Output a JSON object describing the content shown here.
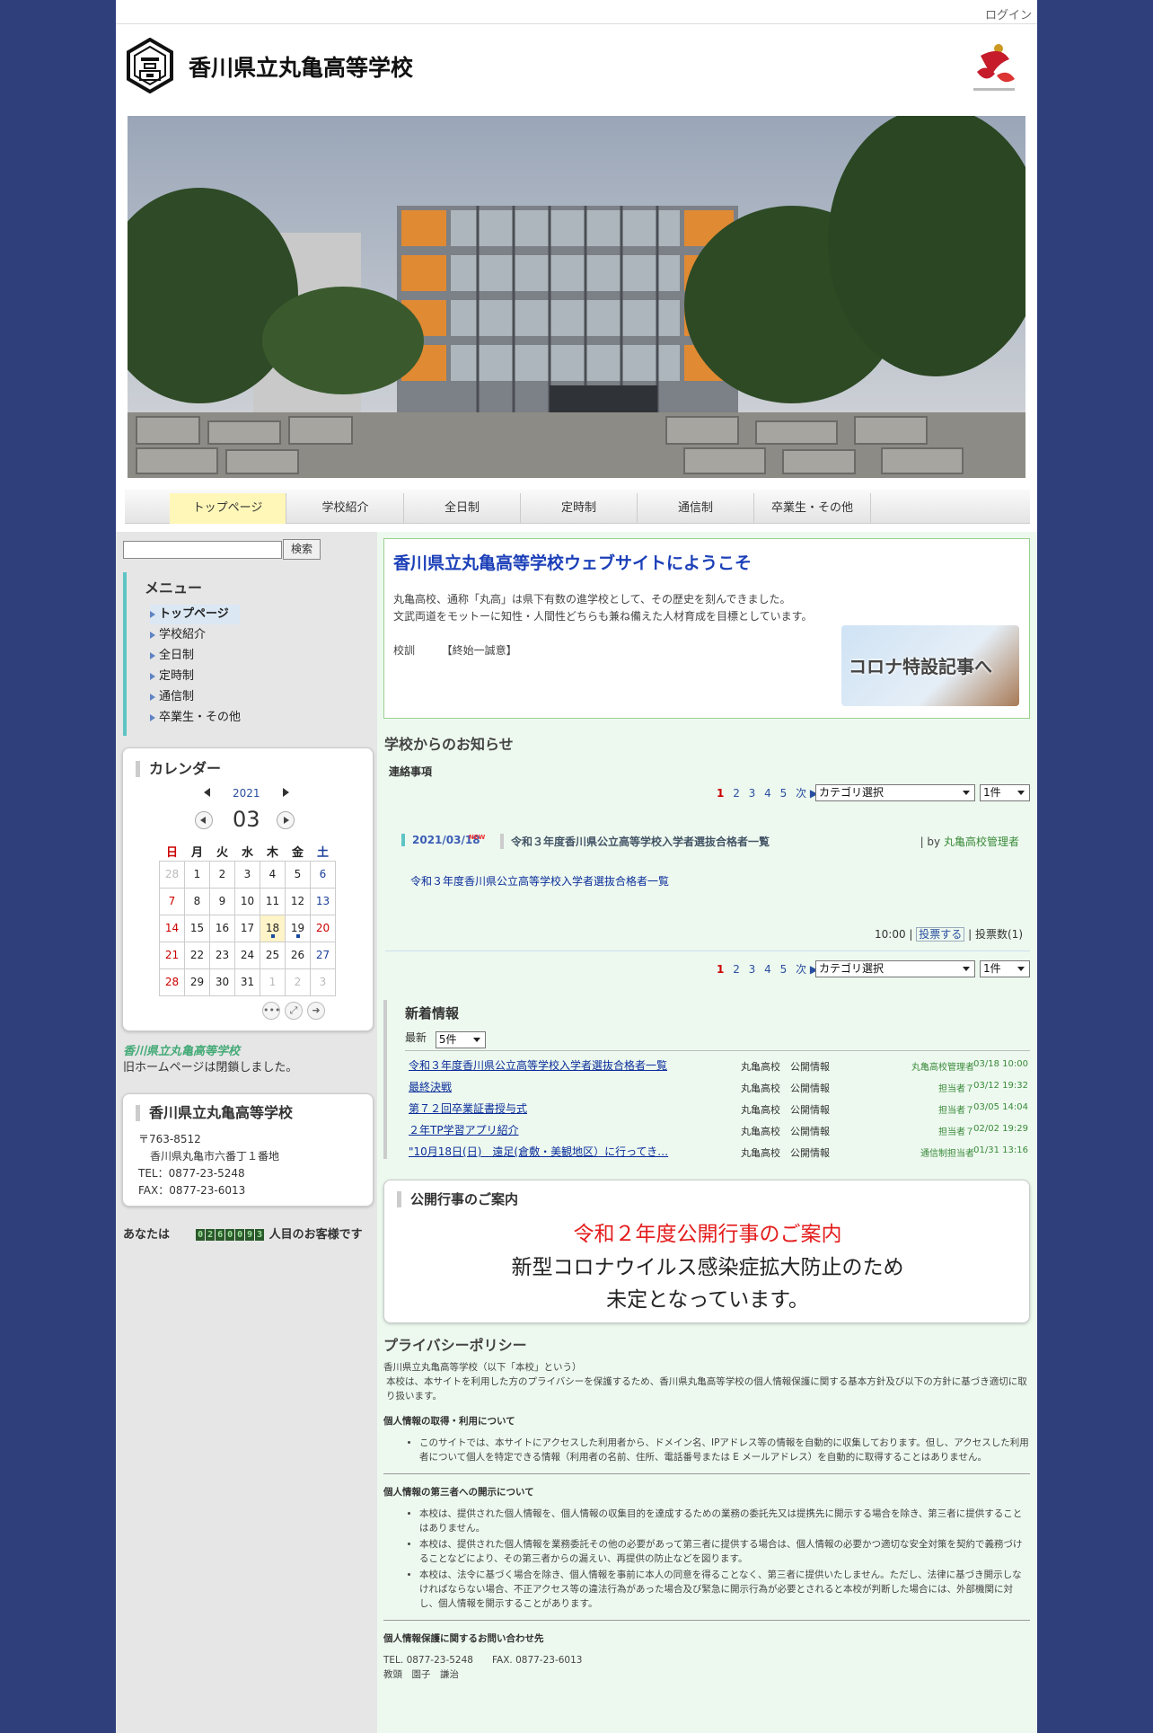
{
  "header": {
    "login": "ログイン",
    "site_title": "香川県立丸亀高等学校"
  },
  "nav": {
    "items": [
      {
        "label": "トップページ",
        "active": true
      },
      {
        "label": "学校紹介"
      },
      {
        "label": "全日制"
      },
      {
        "label": "定時制"
      },
      {
        "label": "通信制"
      },
      {
        "label": "卒業生・その他"
      }
    ]
  },
  "search": {
    "button": "検索",
    "value": ""
  },
  "menu": {
    "title": "メニュー",
    "items": [
      "トップページ",
      "学校紹介",
      "全日制",
      "定時制",
      "通信制",
      "卒業生・その他"
    ]
  },
  "calendar": {
    "title": "カレンダー",
    "year": "2021",
    "month": "03",
    "weekdays": [
      "日",
      "月",
      "火",
      "水",
      "木",
      "金",
      "土"
    ],
    "weeks": [
      [
        "28",
        "1",
        "2",
        "3",
        "4",
        "5",
        "6"
      ],
      [
        "7",
        "8",
        "9",
        "10",
        "11",
        "12",
        "13"
      ],
      [
        "14",
        "15",
        "16",
        "17",
        "18",
        "19",
        "20"
      ],
      [
        "21",
        "22",
        "23",
        "24",
        "25",
        "26",
        "27"
      ],
      [
        "28",
        "29",
        "30",
        "31",
        "1",
        "2",
        "3"
      ]
    ]
  },
  "old_homepage": {
    "banner": "香川県立丸亀高等学校",
    "note": "旧ホームページは閉鎖しました。"
  },
  "address": {
    "title": "香川県立丸亀高等学校",
    "postal": "〒763-8512",
    "street": "香川県丸亀市六番丁１番地",
    "tel": "TEL：0877-23-5248",
    "fax": "FAX：0877-23-6013"
  },
  "counter": {
    "prefix": "あなたは",
    "digits": "0260093",
    "suffix": "人目のお客様です"
  },
  "welcome": {
    "title": "香川県立丸亀高等学校ウェブサイトにようこそ",
    "line1": "丸亀高校、通称「丸高」は県下有数の進学校として、その歴史を刻んできました。",
    "line2": "文武両道をモットーに知性・人間性どちらも兼ね備えた人材育成を目標としています。",
    "motto_label": "校訓",
    "motto": "【終始一誠意】",
    "banner": "コロナ特設記事へ"
  },
  "notices": {
    "title": "学校からのお知らせ",
    "subtitle": "連絡事項",
    "pages": [
      "1",
      "2",
      "3",
      "4",
      "5"
    ],
    "next": "次",
    "category_select": "カテゴリ選択",
    "count_select": "1件",
    "post": {
      "date": "2021/03/18",
      "new_badge": "NEW",
      "title": "令和３年度香川県公立高等学校入学者選抜合格者一覧",
      "by": "| by",
      "author": "丸亀高校管理者",
      "link": "令和３年度香川県公立高等学校入学者選抜合格者一覧",
      "time": "10:00 |",
      "vote": "投票する",
      "votes": "| 投票数(1)"
    }
  },
  "whats_new": {
    "title": "新着情報",
    "latest_label": "最新",
    "latest_select": "5件",
    "rows": [
      {
        "title": "令和３年度香川県公立高等学校入学者選抜合格者一覧",
        "category": "丸亀高校　公開情報",
        "author": "丸亀高校管理者",
        "date": "03/18 10:00"
      },
      {
        "title": "最終決戦",
        "category": "丸亀高校　公開情報",
        "author": "担当者７",
        "date": "03/12 19:32"
      },
      {
        "title": "第７２回卒業証書授与式",
        "category": "丸亀高校　公開情報",
        "author": "担当者７",
        "date": "03/05 14:04"
      },
      {
        "title": "２年TP学習アプリ紹介",
        "category": "丸亀高校　公開情報",
        "author": "担当者７",
        "date": "02/02 19:29"
      },
      {
        "title": "\"10月18日(日)　遠足(倉敷・美観地区）に行ってき…",
        "category": "丸亀高校　公開情報",
        "author": "通信制担当者",
        "date": "01/31 13:16"
      }
    ]
  },
  "events": {
    "title": "公開行事のご案内",
    "line1": "令和２年度公開行事のご案内",
    "line2": "新型コロナウイルス感染症拡大防止のため",
    "line3": "未定となっています。"
  },
  "privacy": {
    "title": "プライバシーポリシー",
    "intro1": "香川県立丸亀高等学校（以下「本校」という）",
    "intro2": "本校は、本サイトを利用した方のプライバシーを保護するため、香川県丸亀高等学校の個人情報保護に関する基本方針及び以下の方針に基づき適切に取り扱います。",
    "h1": "個人情報の取得・利用について",
    "p1": "このサイトでは、本サイトにアクセスした利用者から、ドメイン名、IPアドレス等の情報を自動的に収集しております。但し、アクセスした利用者について個人を特定できる情報（利用者の名前、住所、電話番号または E メールアドレス）を自動的に取得することはありません。",
    "h2": "個人情報の第三者への開示について",
    "p2a": "本校は、提供された個人情報を、個人情報の収集目的を達成するための業務の委託先又は提携先に開示する場合を除き、第三者に提供することはありません。",
    "p2b": "本校は、提供された個人情報を業務委託その他の必要があって第三者に提供する場合は、個人情報の必要かつ適切な安全対策を契約で義務づけることなどにより、その第三者からの漏えい、再提供の防止などを図ります。",
    "p2c": "本校は、法令に基づく場合を除き、個人情報を事前に本人の同意を得ることなく、第三者に提供いたしません。ただし、法律に基づき開示しなければならない場合、不正アクセス等の違法行為があった場合及び緊急に開示行為が必要とされると本校が判断した場合には、外部機関に対し、個人情報を開示することがあります。",
    "h3": "個人情報保護に関するお問い合わせ先",
    "contact": "TEL. 0877-23-5248　　FAX. 0877-23-6013",
    "person": "教頭　園子　謙治"
  }
}
